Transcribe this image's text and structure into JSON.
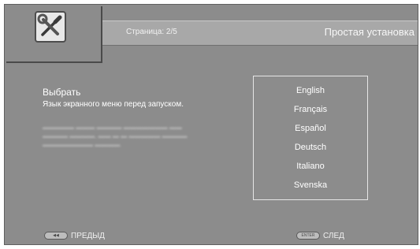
{
  "header": {
    "page_indicator": "Страница: 2/5",
    "title": "Простая установка"
  },
  "logo": {
    "icon": "wrench-screwdriver-icon"
  },
  "content": {
    "heading": "Выбрать",
    "description": "Язык экранного меню перед запуском."
  },
  "languages": [
    "English",
    "Français",
    "Español",
    "Deutsch",
    "Italiano",
    "Svenska"
  ],
  "footer": {
    "prev_label": "ПРЕДЫД",
    "next_label": "СЛЕД",
    "enter_key": "ENTER"
  },
  "colors": {
    "background": "#8c8c8c",
    "header_bar": "#a8a8a8",
    "text": "#ffffff"
  }
}
